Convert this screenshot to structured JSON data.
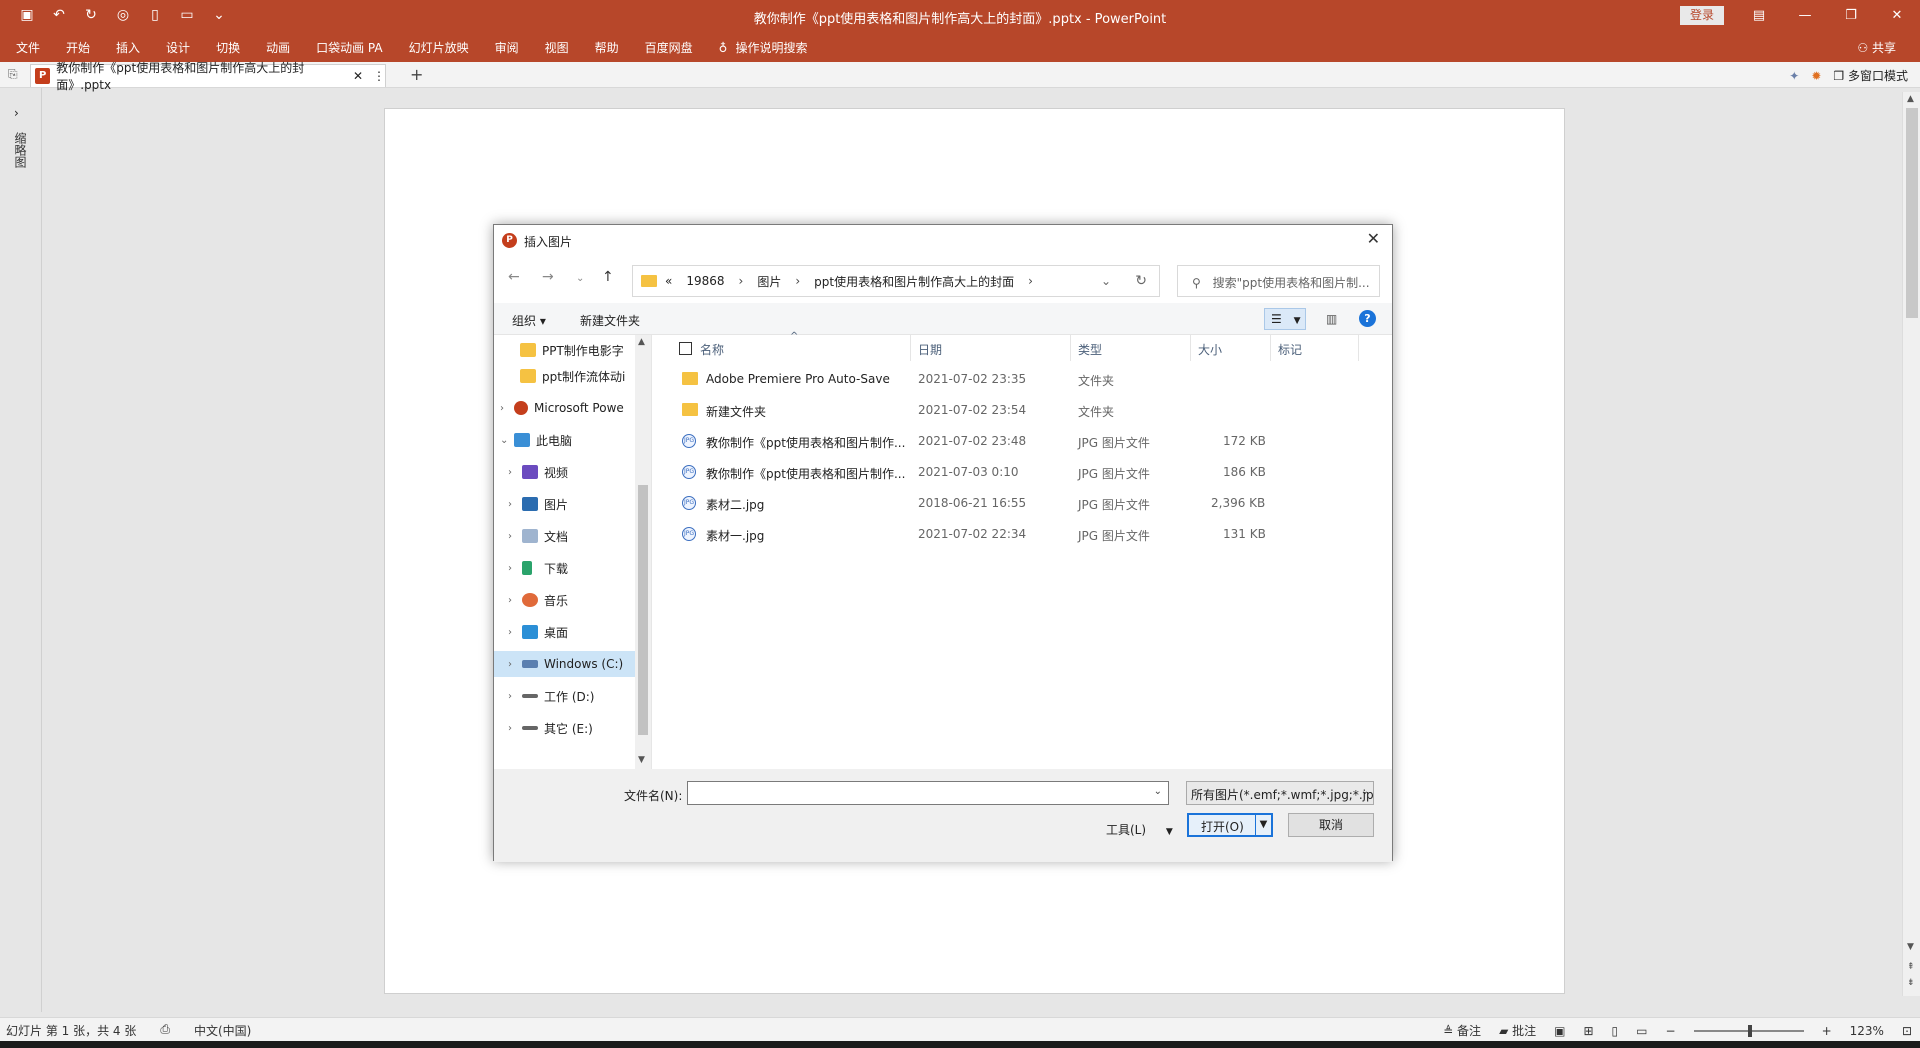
{
  "colors": {
    "brand": "#b7472a",
    "selection": "#cce4f7",
    "accent": "#1a73d9"
  },
  "window": {
    "title": "教你制作《ppt使用表格和图片制作高大上的封面》.pptx  -  PowerPoint",
    "login_label": "登录",
    "share_label": "共享"
  },
  "menu": {
    "items": [
      "文件",
      "开始",
      "插入",
      "设计",
      "切换",
      "动画",
      "口袋动画 PA",
      "幻灯片放映",
      "审阅",
      "视图",
      "帮助",
      "百度网盘",
      "操作说明搜索"
    ]
  },
  "doc_tab": {
    "title": "教你制作《ppt使用表格和图片制作高大上的封面》.pptx",
    "multiwindow_label": "多窗口模式"
  },
  "left_pane": {
    "label": "缩略图"
  },
  "dialog": {
    "title": "插入图片",
    "breadcrumb": [
      "«",
      "19868",
      "图片",
      "ppt使用表格和图片制作高大上的封面"
    ],
    "search_placeholder": "搜索\"ppt使用表格和图片制...",
    "organize_label": "组织 ▾",
    "new_folder_label": "新建文件夹",
    "tree": [
      {
        "label": "PPT制作电影字",
        "icon": "folder-icon"
      },
      {
        "label": "ppt制作流体动i",
        "icon": "folder-icon"
      },
      {
        "label": "Microsoft Powe",
        "icon": "powerpoint-icon"
      },
      {
        "label": "此电脑",
        "icon": "computer-icon"
      },
      {
        "label": "视频",
        "icon": "video-icon"
      },
      {
        "label": "图片",
        "icon": "pictures-icon"
      },
      {
        "label": "文档",
        "icon": "documents-icon"
      },
      {
        "label": "下载",
        "icon": "download-icon"
      },
      {
        "label": "音乐",
        "icon": "music-icon"
      },
      {
        "label": "桌面",
        "icon": "desktop-icon"
      },
      {
        "label": "Windows (C:)",
        "icon": "drive-icon"
      },
      {
        "label": "工作 (D:)",
        "icon": "drive-icon"
      },
      {
        "label": "其它 (E:)",
        "icon": "drive-icon"
      }
    ],
    "columns": {
      "name": "名称",
      "date": "日期",
      "type": "类型",
      "size": "大小",
      "tags": "标记"
    },
    "files": [
      {
        "name": "Adobe Premiere Pro Auto-Save",
        "date": "2021-07-02 23:35",
        "type": "文件夹",
        "size": "",
        "kind": "folder"
      },
      {
        "name": "新建文件夹",
        "date": "2021-07-02 23:54",
        "type": "文件夹",
        "size": "",
        "kind": "folder"
      },
      {
        "name": "教你制作《ppt使用表格和图片制作...",
        "date": "2021-07-02 23:48",
        "type": "JPG 图片文件",
        "size": "172 KB",
        "kind": "jpg"
      },
      {
        "name": "教你制作《ppt使用表格和图片制作...",
        "date": "2021-07-03 0:10",
        "type": "JPG 图片文件",
        "size": "186 KB",
        "kind": "jpg"
      },
      {
        "name": "素材二.jpg",
        "date": "2018-06-21 16:55",
        "type": "JPG 图片文件",
        "size": "2,396 KB",
        "kind": "jpg"
      },
      {
        "name": "素材一.jpg",
        "date": "2021-07-02 22:34",
        "type": "JPG 图片文件",
        "size": "131 KB",
        "kind": "jpg"
      }
    ],
    "filename_label": "文件名(N):",
    "filename_value": "",
    "filter_value": "所有图片(*.emf;*.wmf;*.jpg;*.jp",
    "tools_label": "工具(L)",
    "open_label": "打开(O)",
    "cancel_label": "取消"
  },
  "status": {
    "slide_info": "幻灯片 第 1 张，共 4 张",
    "language": "中文(中国)",
    "notes_label": "备注",
    "comments_label": "批注",
    "zoom": "123%"
  }
}
